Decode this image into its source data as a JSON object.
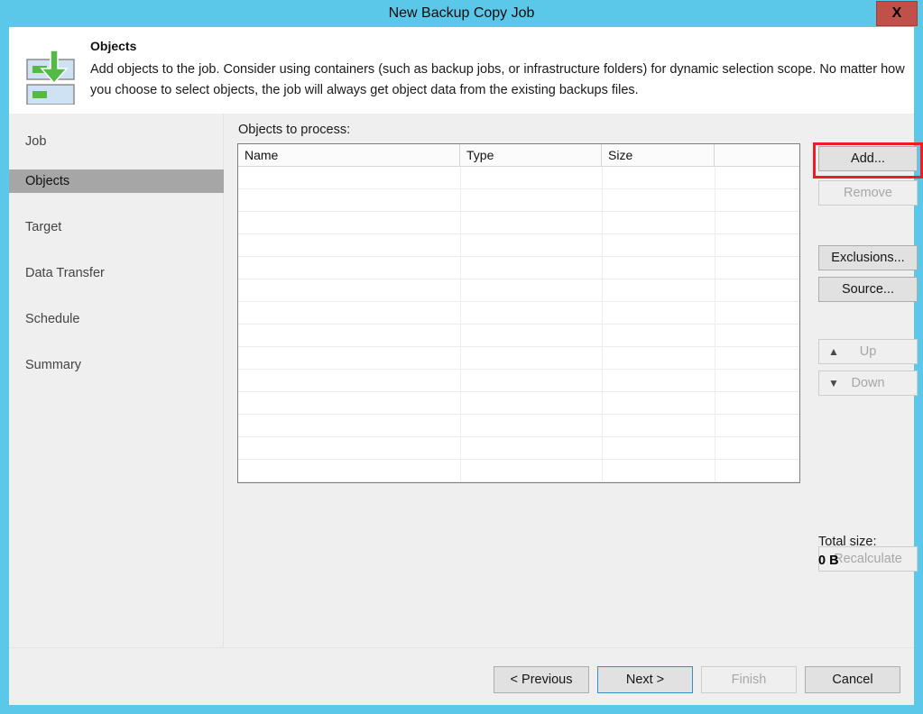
{
  "window": {
    "title": "New Backup Copy Job",
    "close_label": "X"
  },
  "header": {
    "icon": "backup-copy-download-icon",
    "title": "Objects",
    "description": "Add objects to the job. Consider using containers (such as backup jobs, or infrastructure folders) for dynamic selection scope. No matter how you choose to select objects, the job will always get object data from the existing backups files."
  },
  "sidebar": {
    "items": [
      {
        "label": "Job",
        "selected": false
      },
      {
        "label": "Objects",
        "selected": true
      },
      {
        "label": "Target",
        "selected": false
      },
      {
        "label": "Data Transfer",
        "selected": false
      },
      {
        "label": "Schedule",
        "selected": false
      },
      {
        "label": "Summary",
        "selected": false
      }
    ]
  },
  "main": {
    "objects_label": "Objects to process:",
    "grid": {
      "columns": [
        "Name",
        "Type",
        "Size",
        ""
      ],
      "rows": []
    },
    "buttons": {
      "add": "Add...",
      "remove": "Remove",
      "exclusions": "Exclusions...",
      "source": "Source...",
      "up": "Up",
      "down": "Down",
      "recalculate": "Recalculate"
    },
    "up_icon": "arrow-up-icon",
    "down_icon": "arrow-down-icon",
    "total_size_label": "Total size:",
    "total_size_value": "0 B"
  },
  "footer": {
    "previous": "< Previous",
    "next": "Next >",
    "finish": "Finish",
    "cancel": "Cancel"
  },
  "colors": {
    "accent": "#5bc8ea",
    "highlight": "#ee1c25",
    "selected_nav": "#a6a6a6",
    "close_button": "#c1504a",
    "icon_green": "#55b947",
    "icon_blue": "#cfe2f3"
  }
}
